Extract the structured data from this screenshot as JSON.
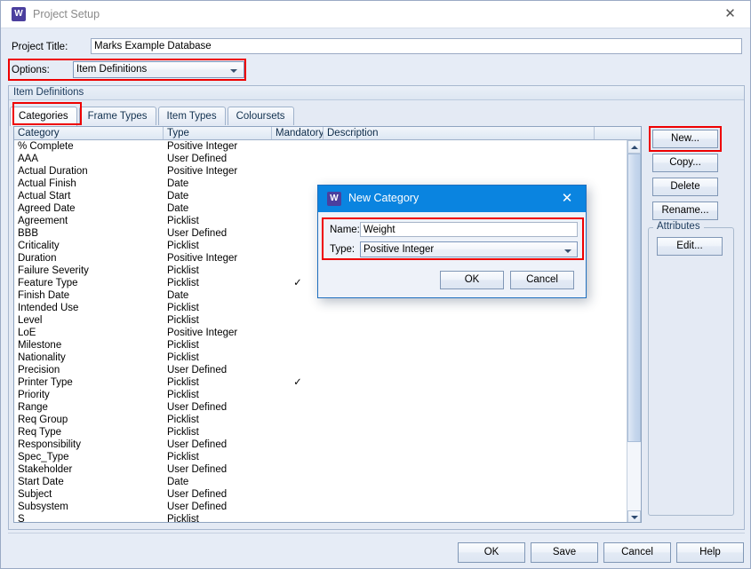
{
  "window": {
    "title": "Project Setup",
    "icon": "w-app-icon",
    "close": "✕"
  },
  "form": {
    "project_title_label": "Project Title:",
    "project_title_value": "Marks Example Database",
    "options_label": "Options:",
    "options_value": "Item Definitions"
  },
  "item_definitions": {
    "group_title": "Item Definitions",
    "tabs": [
      {
        "label": "Categories",
        "active": true
      },
      {
        "label": "Frame Types",
        "active": false
      },
      {
        "label": "Item Types",
        "active": false
      },
      {
        "label": "Coloursets",
        "active": false
      }
    ]
  },
  "table": {
    "columns": [
      "Category",
      "Type",
      "Mandatory",
      "Description"
    ],
    "rows": [
      {
        "category": "% Complete",
        "type": "Positive Integer",
        "mandatory": "",
        "description": ""
      },
      {
        "category": "AAA",
        "type": "User Defined",
        "mandatory": "",
        "description": ""
      },
      {
        "category": "Actual Duration",
        "type": "Positive Integer",
        "mandatory": "",
        "description": ""
      },
      {
        "category": "Actual Finish",
        "type": "Date",
        "mandatory": "",
        "description": ""
      },
      {
        "category": "Actual Start",
        "type": "Date",
        "mandatory": "",
        "description": ""
      },
      {
        "category": "Agreed Date",
        "type": "Date",
        "mandatory": "",
        "description": ""
      },
      {
        "category": "Agreement",
        "type": "Picklist",
        "mandatory": "",
        "description": ""
      },
      {
        "category": "BBB",
        "type": "User Defined",
        "mandatory": "",
        "description": ""
      },
      {
        "category": "Criticality",
        "type": "Picklist",
        "mandatory": "",
        "description": ""
      },
      {
        "category": "Duration",
        "type": "Positive Integer",
        "mandatory": "",
        "description": ""
      },
      {
        "category": "Failure Severity",
        "type": "Picklist",
        "mandatory": "",
        "description": ""
      },
      {
        "category": "Feature Type",
        "type": "Picklist",
        "mandatory": "✓",
        "description": ""
      },
      {
        "category": "Finish Date",
        "type": "Date",
        "mandatory": "",
        "description": ""
      },
      {
        "category": "Intended Use",
        "type": "Picklist",
        "mandatory": "",
        "description": ""
      },
      {
        "category": "Level",
        "type": "Picklist",
        "mandatory": "",
        "description": ""
      },
      {
        "category": "LoE",
        "type": "Positive Integer",
        "mandatory": "",
        "description": ""
      },
      {
        "category": "Milestone",
        "type": "Picklist",
        "mandatory": "",
        "description": ""
      },
      {
        "category": "Nationality",
        "type": "Picklist",
        "mandatory": "",
        "description": ""
      },
      {
        "category": "Precision",
        "type": "User Defined",
        "mandatory": "",
        "description": ""
      },
      {
        "category": "Printer Type",
        "type": "Picklist",
        "mandatory": "✓",
        "description": ""
      },
      {
        "category": "Priority",
        "type": "Picklist",
        "mandatory": "",
        "description": ""
      },
      {
        "category": "Range",
        "type": "User Defined",
        "mandatory": "",
        "description": ""
      },
      {
        "category": "Req Group",
        "type": "Picklist",
        "mandatory": "",
        "description": ""
      },
      {
        "category": "Req Type",
        "type": "Picklist",
        "mandatory": "",
        "description": ""
      },
      {
        "category": "Responsibility",
        "type": "User Defined",
        "mandatory": "",
        "description": ""
      },
      {
        "category": "Spec_Type",
        "type": "Picklist",
        "mandatory": "",
        "description": ""
      },
      {
        "category": "Stakeholder",
        "type": "User Defined",
        "mandatory": "",
        "description": ""
      },
      {
        "category": "Start Date",
        "type": "Date",
        "mandatory": "",
        "description": ""
      },
      {
        "category": "Subject",
        "type": "User Defined",
        "mandatory": "",
        "description": ""
      },
      {
        "category": "Subsystem",
        "type": "User Defined",
        "mandatory": "",
        "description": ""
      },
      {
        "category": "S",
        "type": "Picklist",
        "mandatory": "",
        "description": ""
      }
    ]
  },
  "side_buttons": {
    "new": "New...",
    "copy": "Copy...",
    "delete": "Delete",
    "rename": "Rename...",
    "attributes_group": "Attributes",
    "edit": "Edit..."
  },
  "footer": {
    "ok": "OK",
    "save": "Save",
    "cancel": "Cancel",
    "help": "Help"
  },
  "dialog": {
    "title": "New Category",
    "icon": "w-app-icon",
    "close": "✕",
    "name_label": "Name:",
    "name_value": "Weight",
    "type_label": "Type:",
    "type_value": "Positive Integer",
    "ok": "OK",
    "cancel": "Cancel"
  },
  "colors": {
    "highlight": "#ee0000",
    "dialog_titlebar": "#0a84e0",
    "app_icon": "#4b3f9e",
    "window_background": "#e4eaf4"
  }
}
